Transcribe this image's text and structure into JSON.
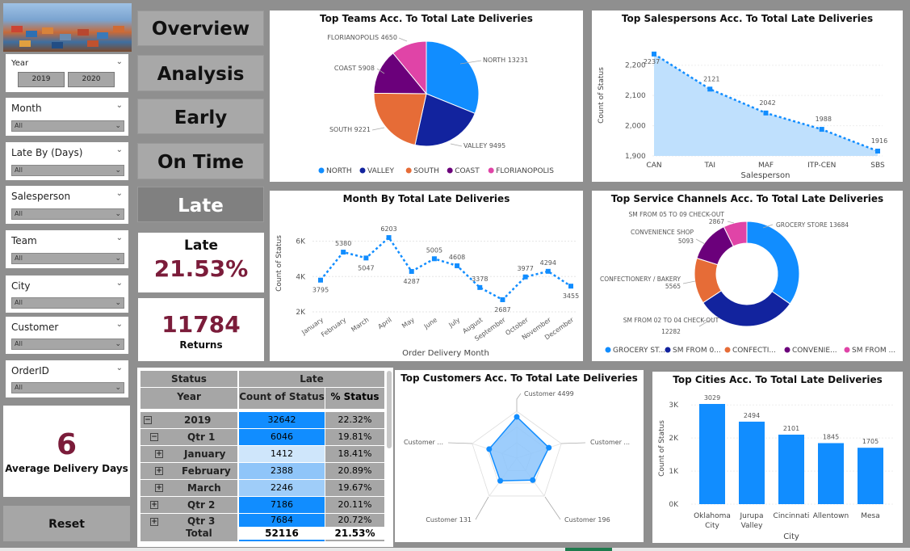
{
  "nav": [
    "Overview",
    "Analysis",
    "Early",
    "On Time",
    "Late"
  ],
  "slicers": {
    "year": {
      "label": "Year",
      "options": [
        "2019",
        "2020"
      ]
    },
    "month": {
      "label": "Month",
      "value": "All"
    },
    "late_by": {
      "label": "Late By (Days)",
      "value": "All"
    },
    "salesperson": {
      "label": "Salesperson",
      "value": "All"
    },
    "team": {
      "label": "Team",
      "value": "All"
    },
    "city": {
      "label": "City",
      "value": "All"
    },
    "customer": {
      "label": "Customer",
      "value": "All"
    },
    "orderid": {
      "label": "OrderID",
      "value": "All"
    }
  },
  "kpi": {
    "late_title": "Late",
    "late_value": "21.53%",
    "returns_value": "11784",
    "returns_label": "Returns",
    "avg_days_value": "6",
    "avg_days_label": "Average Delivery Days"
  },
  "reset_label": "Reset",
  "colors": {
    "blue": "#118dff",
    "navy": "#12239e",
    "orange": "#e66c37",
    "purple": "#6b007b",
    "pink": "#e044a7",
    "accent": "#7b1c3a"
  },
  "matrix": {
    "header_status": "Status",
    "header_late": "Late",
    "col_year": "Year",
    "col_count": "Count of Status",
    "col_pct": "% Status",
    "rows": [
      {
        "label": "2019",
        "count": "32642",
        "pct": "22.32%"
      },
      {
        "label": "Qtr 1",
        "count": "6046",
        "pct": "19.81%"
      },
      {
        "label": "January",
        "count": "1412",
        "pct": "18.41%"
      },
      {
        "label": "February",
        "count": "2388",
        "pct": "20.89%"
      },
      {
        "label": "March",
        "count": "2246",
        "pct": "19.67%"
      },
      {
        "label": "Qtr 2",
        "count": "7186",
        "pct": "20.11%"
      },
      {
        "label": "Qtr 3",
        "count": "7684",
        "pct": "20.72%"
      }
    ],
    "total_label": "Total",
    "total_count": "52116",
    "total_pct": "21.53%"
  },
  "chart_data": [
    {
      "type": "pie",
      "title": "Top Teams Acc. To Total Late Deliveries",
      "categories": [
        "NORTH",
        "VALLEY",
        "SOUTH",
        "COAST",
        "FLORIANOPOLIS"
      ],
      "values": [
        13231,
        9495,
        9221,
        5908,
        4650
      ],
      "slice_labels": [
        "NORTH 13231",
        "VALLEY 9495",
        "SOUTH 9221",
        "COAST 5908",
        "FLORIANOPOLIS 4650"
      ],
      "legend": "bottom"
    },
    {
      "type": "area",
      "title": "Top Salespersons Acc. To Total Late Deliveries",
      "categories": [
        "CAN",
        "TAI",
        "MAF",
        "ITP-CEN",
        "SBS"
      ],
      "values": [
        2237,
        2121,
        2042,
        1988,
        1916
      ],
      "xlabel": "Salesperson",
      "ylabel": "Count of Status",
      "yticks": [
        "1,900",
        "2,000",
        "2,100",
        "2,200"
      ],
      "ylim": [
        1900,
        2250
      ]
    },
    {
      "type": "line",
      "title": "Month By Total Late Deliveries",
      "categories": [
        "January",
        "February",
        "March",
        "April",
        "May",
        "June",
        "July",
        "August",
        "September",
        "October",
        "November",
        "December"
      ],
      "values": [
        3795,
        5380,
        5047,
        6203,
        4287,
        5005,
        4608,
        3378,
        2687,
        3977,
        4294,
        3455
      ],
      "xlabel": "Order Delivery Month",
      "ylabel": "Count of Status",
      "yticks": [
        "2K",
        "4K",
        "6K"
      ],
      "ylim": [
        2000,
        6800
      ]
    },
    {
      "type": "pie",
      "title": "Top Service Channels Acc. To Total Late Deliveries",
      "categories": [
        "GROCERY STORE",
        "SM FROM 02 TO 04 CHECK-OUT",
        "CONFECTIONERY / BAKERY",
        "CONVENIENCE SHOP",
        "SM FROM 05 TO 09 CHECK-OUT"
      ],
      "values": [
        13684,
        12282,
        5565,
        5093,
        2867
      ],
      "slice_labels": [
        "GROCERY STORE 13684",
        "SM FROM 02 TO 04 CHECK-OUT",
        "12282",
        "CONFECTIONERY / BAKERY",
        "5565",
        "CONVENIENCE SHOP",
        "5093",
        "SM FROM 05 TO 09 CHECK-OUT",
        "2867"
      ],
      "legend_labels": [
        "GROCERY ST...",
        "SM FROM 0...",
        "CONFECTI...",
        "CONVENIE...",
        "SM FROM ..."
      ],
      "legend": "bottom"
    },
    {
      "type": "radar",
      "title": "Top Customers Acc. To Total Late Deliveries",
      "categories": [
        "Customer 4499",
        "Customer ...",
        "Customer 196",
        "Customer 131",
        "Customer ..."
      ]
    },
    {
      "type": "bar",
      "title": "Top Cities Acc. To Total Late Deliveries",
      "categories": [
        "Oklahoma City",
        "Jurupa Valley",
        "Cincinnati",
        "Allentown",
        "Mesa"
      ],
      "values": [
        3029,
        2494,
        2101,
        1845,
        1705
      ],
      "xlabel": "City",
      "ylabel": "Count of Status",
      "yticks": [
        "0K",
        "1K",
        "2K",
        "3K"
      ],
      "ylim": [
        0,
        3200
      ]
    }
  ]
}
